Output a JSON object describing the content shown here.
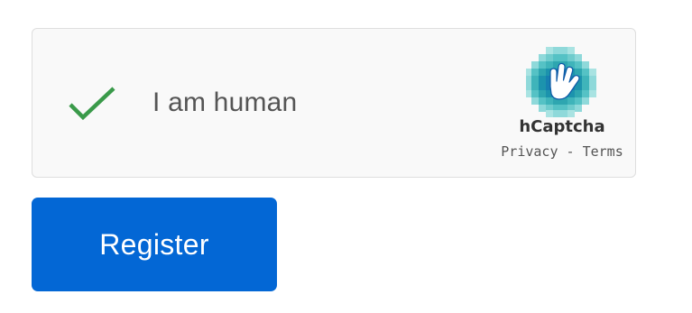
{
  "captcha": {
    "label": "I am human",
    "checked": true,
    "check_color": "#3a9a4a",
    "icon": "checkmark-icon",
    "brand": {
      "name": "hCaptcha",
      "logo_icon": "hcaptcha-hand-logo",
      "privacy_link": "Privacy",
      "separator": "-",
      "terms_link": "Terms"
    }
  },
  "form": {
    "register_label": "Register",
    "button_color": "#0367d5"
  }
}
